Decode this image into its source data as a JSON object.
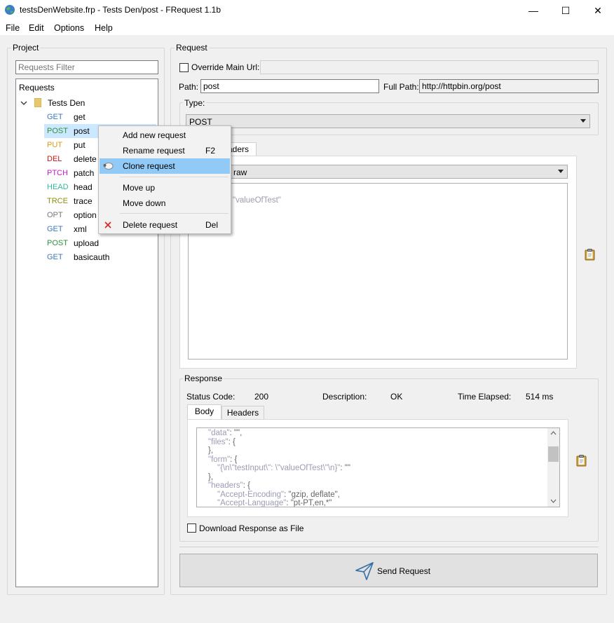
{
  "window": {
    "title": "testsDenWebsite.frp - Tests Den/post - FRequest 1.1b",
    "minimize_glyph": "—",
    "maximize_glyph": "☐",
    "close_glyph": "✕"
  },
  "menubar": {
    "items": [
      "File",
      "Edit",
      "Options",
      "Help"
    ]
  },
  "project": {
    "title": "Project",
    "filter_placeholder": "Requests Filter",
    "tree_header": "Requests",
    "folder_name": "Tests Den",
    "requests": [
      {
        "method": "GET",
        "name": "get",
        "color": "#3a78b5"
      },
      {
        "method": "POST",
        "name": "post",
        "color": "#2f8f3a",
        "selected": true
      },
      {
        "method": "PUT",
        "name": "put",
        "color": "#d89b16"
      },
      {
        "method": "DEL",
        "name": "delete",
        "color": "#c41818"
      },
      {
        "method": "PTCH",
        "name": "patch",
        "color": "#c518c5"
      },
      {
        "method": "HEAD",
        "name": "head",
        "color": "#32b89b"
      },
      {
        "method": "TRCE",
        "name": "trace",
        "color": "#8d8d0a"
      },
      {
        "method": "OPT",
        "name": "option",
        "color": "#777777"
      },
      {
        "method": "GET",
        "name": "xml",
        "color": "#3a78b5"
      },
      {
        "method": "POST",
        "name": "upload",
        "color": "#2f8f3a"
      },
      {
        "method": "GET",
        "name": "basicauth",
        "color": "#3a78b5"
      }
    ]
  },
  "context_menu": {
    "items": [
      {
        "label": "Add new request",
        "shortcut": ""
      },
      {
        "label": "Rename request",
        "shortcut": "F2"
      },
      {
        "label": "Clone request",
        "shortcut": "",
        "highlighted": true
      },
      {
        "label": "Move up",
        "shortcut": ""
      },
      {
        "label": "Move down",
        "shortcut": ""
      },
      {
        "label": "Delete request",
        "shortcut": "Del"
      }
    ]
  },
  "request": {
    "title": "Request",
    "override_label": "Override Main Url:",
    "override_checked": false,
    "path_label": "Path:",
    "path_value": "post",
    "fullpath_label": "Full Path:",
    "fullpath_value": "http://httpbin.org/post",
    "type_label": "Type:",
    "type_value": "POST",
    "tab_partial": "aders",
    "body_type_value": "raw",
    "body_partial_text": "\"valueOfTest\""
  },
  "response": {
    "title": "Response",
    "status_label": "Status Code:",
    "status_value": "200",
    "description_label": "Description:",
    "description_value": "OK",
    "elapsed_label": "Time Elapsed:",
    "elapsed_value": "514 ms",
    "tabs": [
      "Body",
      "Headers"
    ],
    "body_lines": [
      {
        "indent": 0,
        "key": "\"data\"",
        "rest": ": \"\","
      },
      {
        "indent": 0,
        "key": "\"files\"",
        "rest": ": {"
      },
      {
        "indent": 0,
        "key": "",
        "rest": "},"
      },
      {
        "indent": 0,
        "key": "\"form\"",
        "rest": ": {"
      },
      {
        "indent": 1,
        "key": "\"{\\n\\\"testInput\\\": \\\"valueOfTest\\\"\\n}\"",
        "rest": ": \"\""
      },
      {
        "indent": 0,
        "key": "",
        "rest": "},"
      },
      {
        "indent": 0,
        "key": "\"headers\"",
        "rest": ": {"
      },
      {
        "indent": 1,
        "key": "\"Accept-Encoding\"",
        "rest": ": \"gzip, deflate\","
      },
      {
        "indent": 1,
        "key": "\"Accept-Language\"",
        "rest": ": \"pt-PT,en,*\""
      }
    ],
    "download_label": "Download Response as File",
    "download_checked": false
  },
  "send_label": "Send Request",
  "icons": {
    "clone": "sheep-icon",
    "delete": "delete-x-icon",
    "clipboard": "clipboard-icon",
    "send": "paper-plane-icon"
  }
}
